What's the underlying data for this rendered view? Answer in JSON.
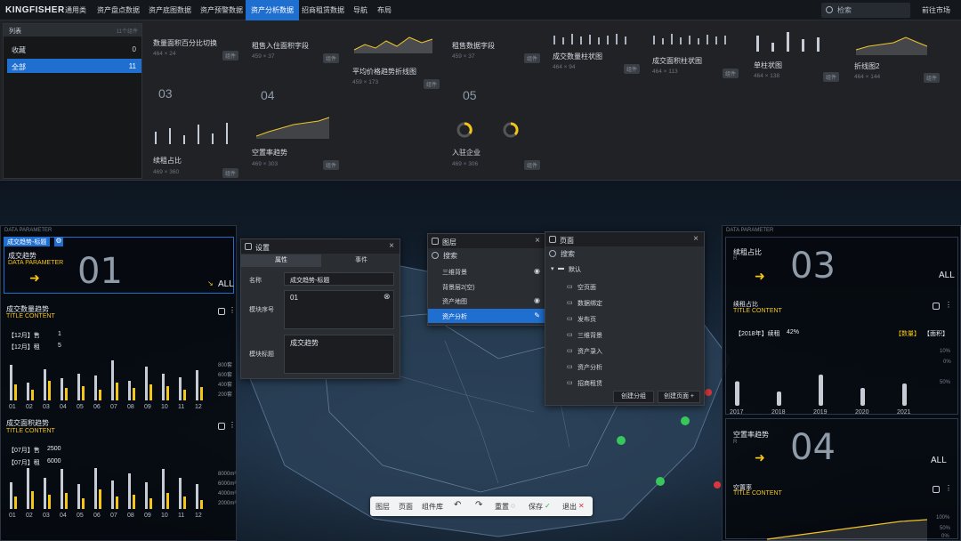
{
  "nav": {
    "logo": "KINGFISHER",
    "items": [
      "通用类",
      "资产盘点数据",
      "资产底图数据",
      "资产预警数据",
      "资产分析数据",
      "招商租赁数据",
      "导航",
      "布局"
    ],
    "active_index": 4,
    "search_placeholder": "检索",
    "market_link": "前往市场"
  },
  "library": {
    "list_title": "列表",
    "list_count_label": "11个组件",
    "categories": [
      {
        "label": "收藏",
        "count": "0"
      },
      {
        "label": "全部",
        "count": "11"
      }
    ],
    "cards": [
      {
        "title": "数量面积百分比切换",
        "size": "464 × 24",
        "tag": "组件"
      },
      {
        "title": "租售入住面积字段",
        "size": "459 × 37",
        "tag": "组件"
      },
      {
        "title": "平均价格趋势折线图",
        "size": "459 × 173",
        "tag": "组件"
      },
      {
        "title": "租售数据字段",
        "size": "459 × 37",
        "tag": "组件"
      },
      {
        "title": "成交数量柱状图",
        "size": "464 × 94",
        "tag": "组件"
      },
      {
        "title": "成交面积柱状图",
        "size": "464 × 113",
        "tag": "组件"
      },
      {
        "title": "单柱状图",
        "size": "464 × 138",
        "tag": "组件"
      },
      {
        "title": "折线图2",
        "size": "464 × 144",
        "tag": "组件"
      },
      {
        "title": "续租占比",
        "size": "469 × 360",
        "tag": "组件",
        "num": "03"
      },
      {
        "title": "空置率趋势",
        "size": "469 × 303",
        "tag": "组件",
        "num": "04"
      },
      {
        "title": "入驻企业",
        "size": "469 × 306",
        "tag": "组件",
        "num": "05"
      }
    ]
  },
  "left_dash": {
    "header_label": "DATA PARAMETER",
    "selected_tag": "成交趋势-标题",
    "block1": {
      "title": "成交趋势",
      "subtitle": "DATA PARAMETER",
      "num": "01",
      "all": "ALL"
    },
    "block2": {
      "title": "成交数量趋势",
      "subtitle": "TITLE CONTENT",
      "rows": [
        [
          "【12月】售",
          "1"
        ],
        [
          "【12月】租",
          "5"
        ]
      ]
    },
    "block3": {
      "title": "成交面积趋势",
      "subtitle": "TITLE CONTENT",
      "rows": [
        [
          "【07月】售",
          "2500"
        ],
        [
          "【07月】租",
          "6000"
        ]
      ]
    },
    "xlabels": [
      "01",
      "02",
      "03",
      "04",
      "05",
      "06",
      "07",
      "08",
      "09",
      "10",
      "11",
      "12"
    ],
    "y1": [
      "800套",
      "600套",
      "400套",
      "200套"
    ],
    "y2": [
      "8000m²",
      "6000m²",
      "4000m²",
      "2000m²"
    ],
    "bars1": [
      40,
      20,
      35,
      25,
      30,
      28,
      45,
      22,
      38,
      30,
      26,
      34
    ],
    "bars1b": [
      18,
      12,
      22,
      14,
      16,
      12,
      20,
      14,
      18,
      16,
      12,
      15
    ],
    "bars2": [
      30,
      55,
      35,
      45,
      28,
      50,
      32,
      40,
      30,
      45,
      35,
      28
    ],
    "bars2b": [
      14,
      20,
      16,
      18,
      12,
      22,
      14,
      16,
      12,
      18,
      14,
      10
    ]
  },
  "settings": {
    "title": "设置",
    "tabs": [
      "属性",
      "事件"
    ],
    "name_label": "名称",
    "name_value": "成交趋势-标题",
    "seq_label": "模块序号",
    "seq_value": "01",
    "title_label": "模块标题",
    "title_value": "成交趋势"
  },
  "layers": {
    "title": "图层",
    "search_placeholder": "搜索",
    "items": [
      "三维背景",
      "背景层2(空)",
      "资产地图",
      "资产分析"
    ],
    "selected_index": 3
  },
  "pages": {
    "title": "页面",
    "search_placeholder": "搜索",
    "folder": "默认",
    "items": [
      "空页面",
      "数据绑定",
      "发布页",
      "三维背景",
      "资产录入",
      "资产分析",
      "招商租赁"
    ],
    "create_group": "创建分组",
    "create_page": "创建页面"
  },
  "right_dash": {
    "header_label": "DATA PARAMETER",
    "block1": {
      "title": "续租占比",
      "sub": "R",
      "num": "03",
      "all": "ALL",
      "inner_title": "续租占比",
      "inner_sub": "TITLE CONTENT",
      "stat_year": "【2018年】续租",
      "stat_pct": "42%",
      "tab1": "【数量】",
      "tab2": "【面积】",
      "years": [
        "2017",
        "2018",
        "2019",
        "2020",
        "2021"
      ],
      "pcts": [
        "10%",
        "0%",
        "50%"
      ],
      "bars": [
        0.55,
        0.32,
        0.7,
        0.4,
        0.5
      ]
    },
    "block2": {
      "title": "空置率趋势",
      "sub": "R",
      "num": "04",
      "all": "ALL",
      "inner_title": "空置率",
      "inner_sub": "TITLE CONTENT",
      "pcts": [
        "100%",
        "50%",
        "0%"
      ]
    }
  },
  "bottom_toolbar": {
    "items": [
      "图层",
      "页面",
      "组件库"
    ],
    "reset": "重置",
    "save": "保存",
    "exit": "退出"
  },
  "colors": {
    "accent": "#1f6fd1",
    "highlight": "#f5c518"
  }
}
